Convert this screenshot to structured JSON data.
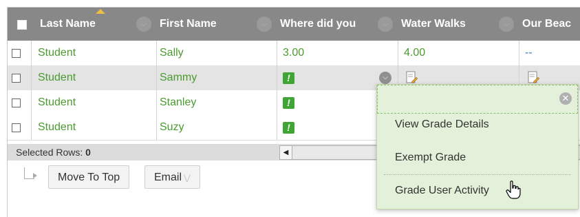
{
  "grid": {
    "columns": [
      {
        "key": "select_all",
        "label": ""
      },
      {
        "key": "last_name",
        "label": "Last Name"
      },
      {
        "key": "first_name",
        "label": "First Name"
      },
      {
        "key": "where_did_you",
        "label": "Where did you"
      },
      {
        "key": "water_walks",
        "label": "Water Walks"
      },
      {
        "key": "our_beach",
        "label": "Our Beac"
      }
    ],
    "rows": [
      {
        "last": "Student",
        "first": "Sally",
        "where": "3.00",
        "water": "4.00",
        "beach": "--"
      },
      {
        "last": "Student",
        "first": "Sammy",
        "where": "alert-icon",
        "water": "pencil-icon",
        "beach": "pencil-icon"
      },
      {
        "last": "Student",
        "first": "Stanley",
        "where": "alert-icon",
        "water": "",
        "beach": ""
      },
      {
        "last": "Student",
        "first": "Suzy",
        "where": "alert-icon",
        "water": "",
        "beach": ""
      }
    ],
    "alert_glyph": "!"
  },
  "footer": {
    "selected_rows_label": "Selected Rows:",
    "selected_rows_count": "0"
  },
  "actions": {
    "move_to_top": "Move To Top",
    "email": "Email"
  },
  "context_menu": {
    "items": [
      "View Grade Details",
      "Exempt Grade",
      "Grade User Activity"
    ]
  },
  "colors": {
    "header_bg": "#888888",
    "link_green": "#4a9a2f",
    "alert_green": "#3fa535",
    "menu_bg": "#e3f0da",
    "dash_blue": "#3a7ec0"
  }
}
